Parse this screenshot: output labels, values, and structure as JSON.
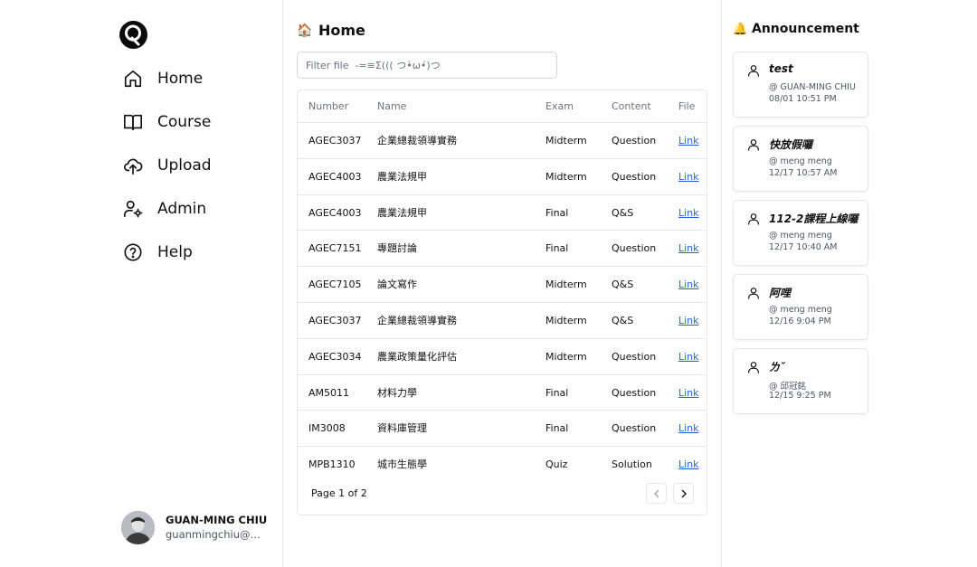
{
  "sidebar": {
    "nav": [
      {
        "label": "Home",
        "icon": "home-icon"
      },
      {
        "label": "Course",
        "icon": "book-icon"
      },
      {
        "label": "Upload",
        "icon": "cloud-upload-icon"
      },
      {
        "label": "Admin",
        "icon": "user-cog-icon"
      },
      {
        "label": "Help",
        "icon": "help-circle-icon"
      }
    ],
    "user": {
      "name": "GUAN-MING CHIU",
      "email": "guanmingchiu@gm..."
    }
  },
  "main": {
    "title_emoji": "🏠",
    "title": "Home",
    "filter_placeholder": "Filter file  -=≡Σ((( つ•̀ω•́)つ",
    "columns": [
      "Number",
      "Name",
      "Exam",
      "Content",
      "File"
    ],
    "rows": [
      {
        "number": "AGEC3037",
        "name": "企業總裁領導實務",
        "exam": "Midterm",
        "content": "Question",
        "file": "Link"
      },
      {
        "number": "AGEC4003",
        "name": "農業法規甲",
        "exam": "Midterm",
        "content": "Question",
        "file": "Link"
      },
      {
        "number": "AGEC4003",
        "name": "農業法規甲",
        "exam": "Final",
        "content": "Q&S",
        "file": "Link"
      },
      {
        "number": "AGEC7151",
        "name": "專題討論",
        "exam": "Final",
        "content": "Question",
        "file": "Link"
      },
      {
        "number": "AGEC7105",
        "name": "論文寫作",
        "exam": "Midterm",
        "content": "Q&S",
        "file": "Link"
      },
      {
        "number": "AGEC3037",
        "name": "企業總裁領導實務",
        "exam": "Midterm",
        "content": "Q&S",
        "file": "Link"
      },
      {
        "number": "AGEC3034",
        "name": "農業政策量化評估",
        "exam": "Midterm",
        "content": "Question",
        "file": "Link"
      },
      {
        "number": "AM5011",
        "name": "材料力學",
        "exam": "Final",
        "content": "Question",
        "file": "Link"
      },
      {
        "number": "IM3008",
        "name": "資料庫管理",
        "exam": "Final",
        "content": "Question",
        "file": "Link"
      },
      {
        "number": "MPB1310",
        "name": "城市生態學",
        "exam": "Quiz",
        "content": "Solution",
        "file": "Link"
      }
    ],
    "pagination": "Page 1 of 2"
  },
  "announcements": {
    "title_emoji": "🔔",
    "title": "Announcement",
    "items": [
      {
        "title": "test",
        "author": "@ GUAN-MING CHIU",
        "date": "08/01 10:51 PM"
      },
      {
        "title": "快放假囉",
        "author": "@ meng meng",
        "date": "12/17 10:57 AM"
      },
      {
        "title": "112-2課程上線囉",
        "author": "@ meng meng",
        "date": "12/17 10:40 AM"
      },
      {
        "title": "阿哩",
        "author": "@ meng meng",
        "date": "12/16 9:04 PM"
      },
      {
        "title": "ㄌˇ",
        "author": "@ 邱冠銘",
        "date": "12/15 9:25 PM"
      }
    ]
  },
  "colors": {
    "link": "#2563eb",
    "border": "#e5e7eb",
    "muted": "#6b7280"
  }
}
